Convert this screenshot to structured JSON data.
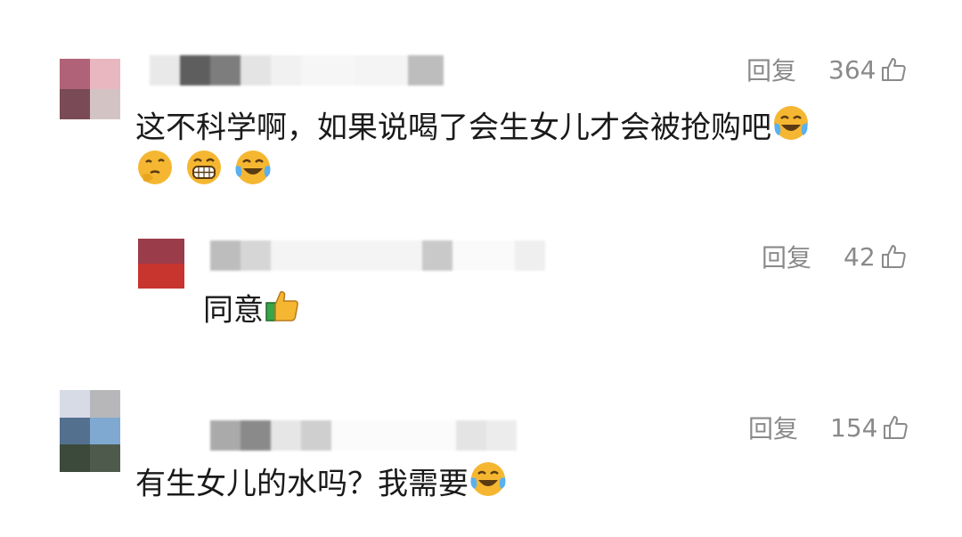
{
  "comments": [
    {
      "reply_label": "回复",
      "like_count": "364",
      "text_line1": "这不科学啊，如果说喝了会生女儿才会被抢购吧",
      "emoji_end_line1": "loudly-crying-laughing-emoji",
      "emojis_line2": [
        "thinking-hand-emoji",
        "grinning-teeth-emoji",
        "tears-of-joy-emoji"
      ]
    },
    {
      "reply_label": "回复",
      "like_count": "42",
      "text": "同意",
      "emoji_end": "thumbs-up-emoji"
    },
    {
      "reply_label": "回复",
      "like_count": "154",
      "text": "有生女儿的水吗？我需要",
      "emoji_end": "tears-of-joy-emoji"
    }
  ],
  "colors": {
    "action_text": "#8a8a8a",
    "comment_text": "#1a1a1a",
    "emoji_yellow": "#f5b731",
    "thumbs_green": "#3aa44a"
  }
}
